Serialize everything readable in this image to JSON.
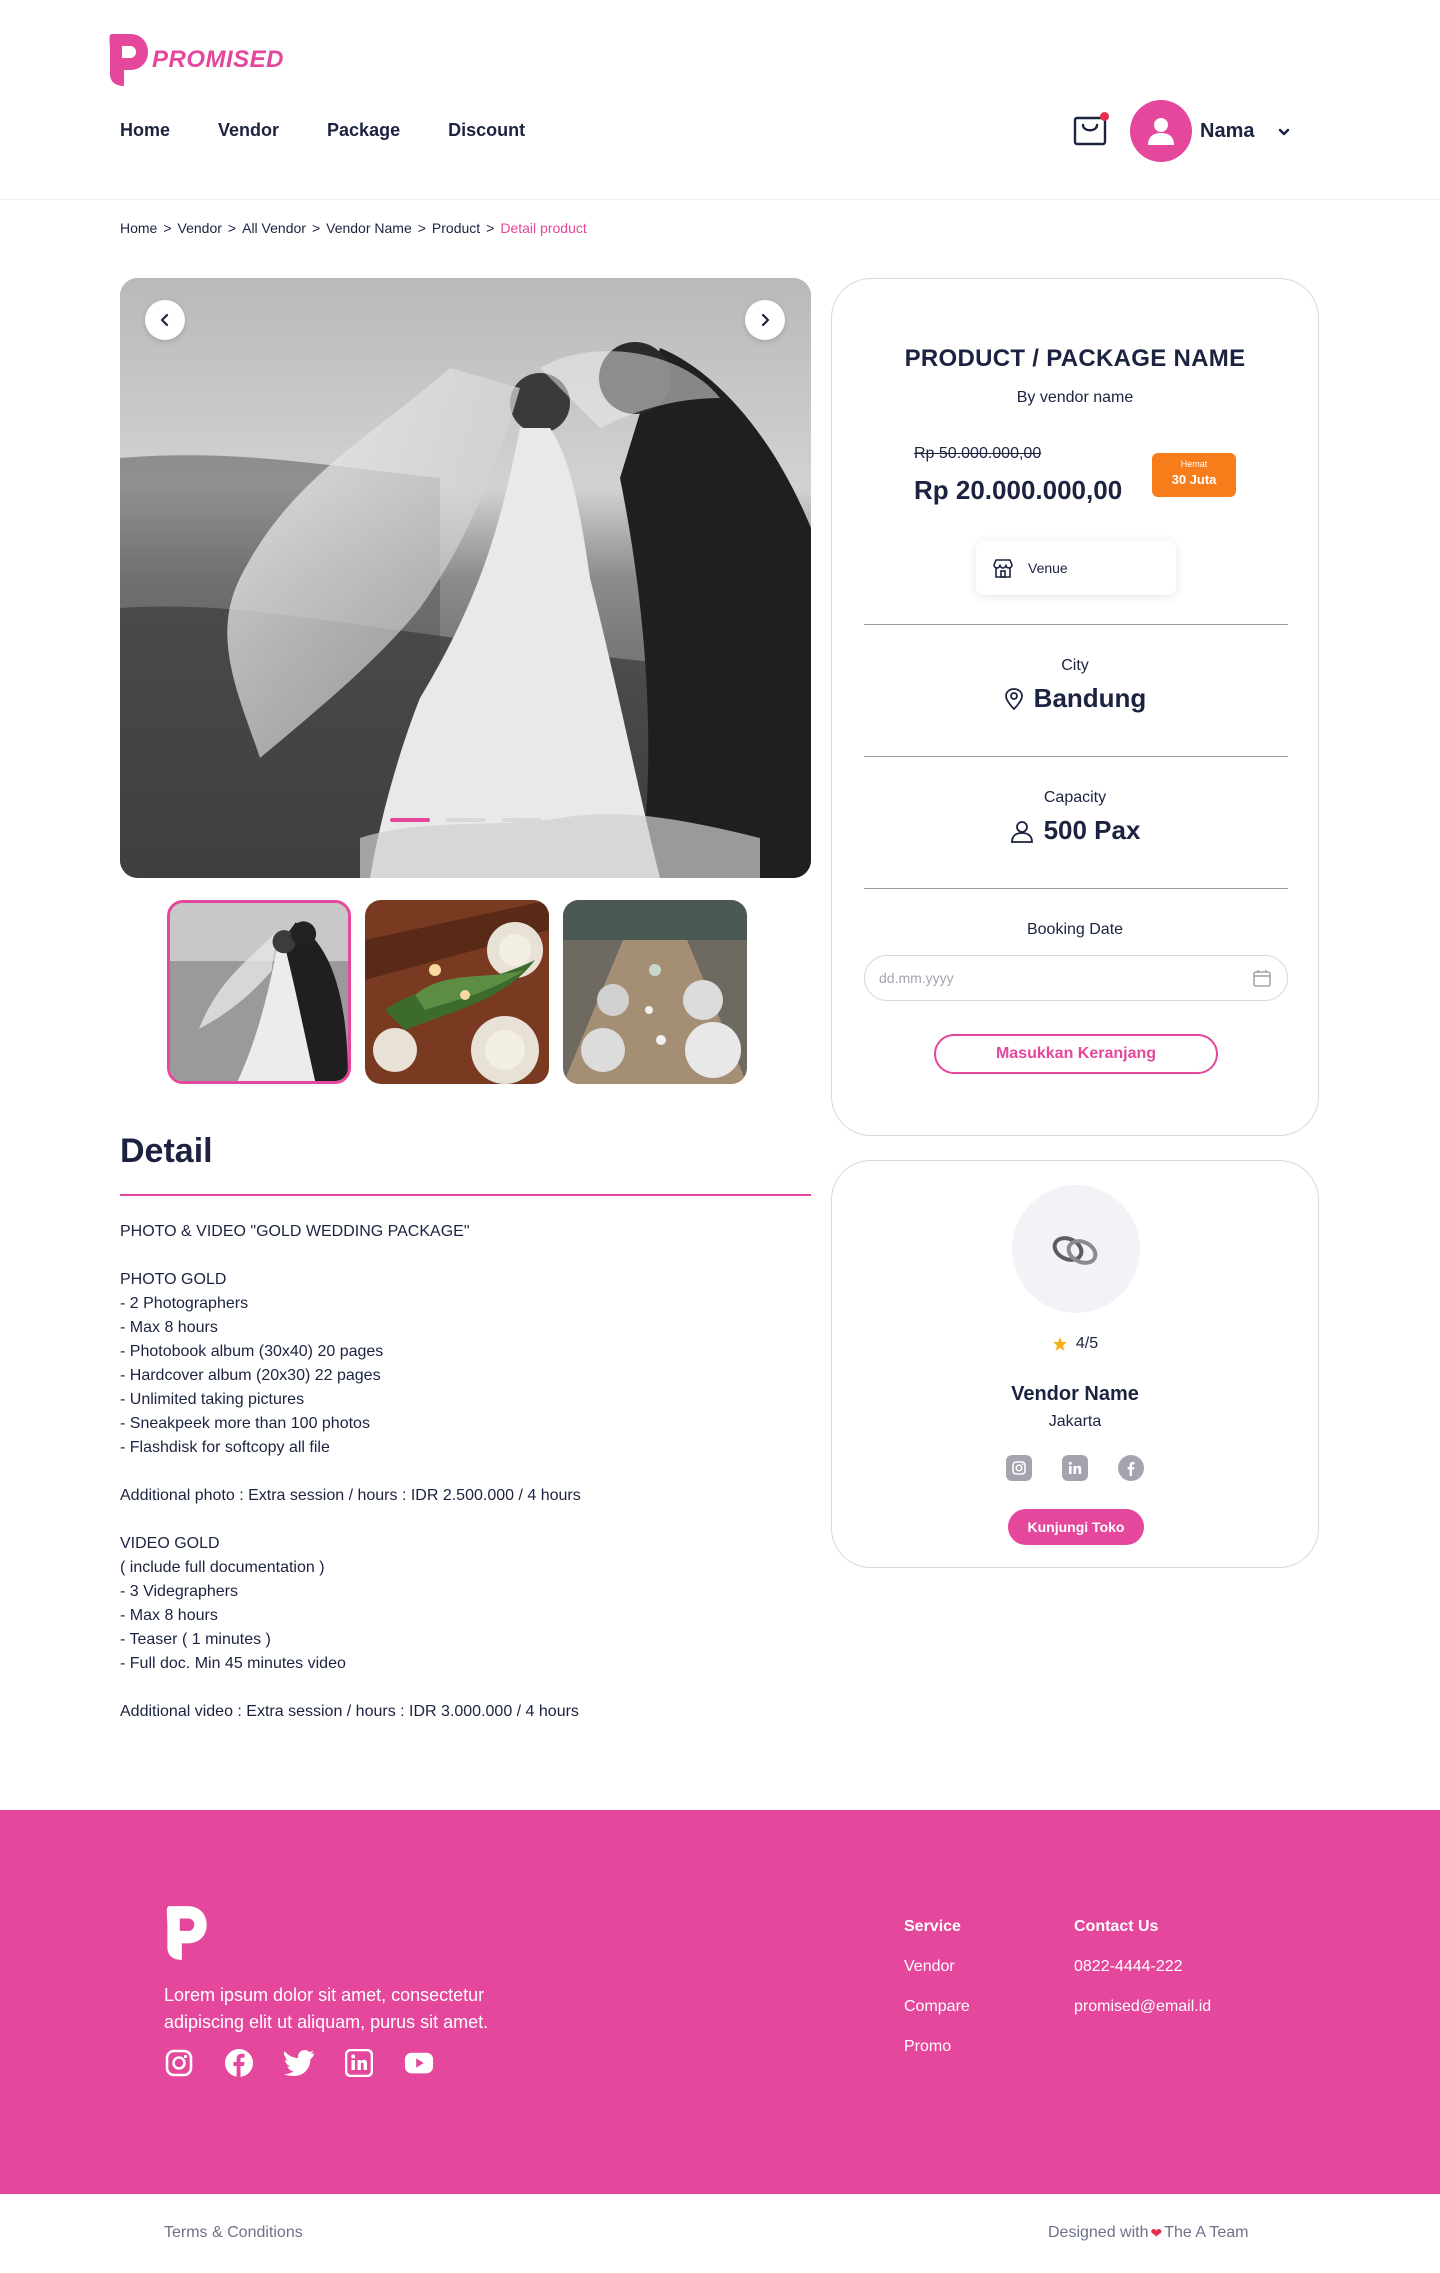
{
  "brand": {
    "name": "PROMISED",
    "logo_icon": "p-logo-icon",
    "color": "#e4479b"
  },
  "nav": {
    "items": [
      {
        "label": "Home"
      },
      {
        "label": "Vendor"
      },
      {
        "label": "Package"
      },
      {
        "label": "Discount"
      }
    ]
  },
  "user": {
    "name": "Nama",
    "cart_icon": "shopping-bag-icon",
    "has_notification": true
  },
  "breadcrumb": {
    "items": [
      "Home",
      "Vendor",
      "All Vendor",
      "Vendor Name",
      "Product"
    ],
    "current": "Detail product"
  },
  "gallery": {
    "slide_count": 3,
    "active_index": 0,
    "thumbnails": [
      {
        "label": "wedding-couple"
      },
      {
        "label": "table-setting-greenery"
      },
      {
        "label": "long-table-setting"
      }
    ]
  },
  "detail": {
    "title": "Detail",
    "lines": [
      "PHOTO & VIDEO \"GOLD WEDDING PACKAGE\"",
      "",
      "PHOTO GOLD",
      "- 2 Photographers",
      "- Max 8 hours",
      "- Photobook album (30x40) 20 pages",
      "- Hardcover album (20x30) 22 pages",
      "- Unlimited taking pictures",
      "- Sneakpeek more than 100 photos",
      "- Flashdisk for softcopy all file",
      "",
      "Additional photo : Extra session / hours : IDR 2.500.000 / 4 hours",
      "",
      "VIDEO GOLD",
      "( include full documentation )",
      "- 3 Videgraphers",
      "- Max 8 hours",
      "- Teaser ( 1 minutes )",
      "- Full doc. Min 45 minutes video",
      "",
      "Additional video : Extra session / hours : IDR 3.000.000 / 4 hours"
    ]
  },
  "product": {
    "name": "PRODUCT / PACKAGE NAME",
    "vendor": "By vendor name",
    "old_price": "Rp 50.000.000,00",
    "price": "Rp  20.000.000,00",
    "badge_label": "Hemat",
    "badge_value": "30 Juta",
    "badge_color": "#f77d1b",
    "category": "Venue",
    "city_label": "City",
    "city": "Bandung",
    "capacity_label": "Capacity",
    "capacity": "500 Pax",
    "booking_label": "Booking Date",
    "booking_placeholder": "dd.mm.yyyy",
    "cart_button": "Masukkan Keranjang"
  },
  "vendor": {
    "rating": "4/5",
    "name": "Vendor Name",
    "city": "Jakarta",
    "socials": [
      "instagram-icon",
      "linkedin-icon",
      "facebook-icon"
    ],
    "visit_button": "Kunjungi Toko"
  },
  "footer": {
    "text": "Lorem ipsum dolor sit amet, consectetur adipiscing elit ut aliquam, purus sit amet.",
    "socials": [
      "instagram-icon",
      "facebook-icon",
      "twitter-icon",
      "linkedin-icon",
      "youtube-icon"
    ],
    "service": {
      "title": "Service",
      "links": [
        "Vendor",
        "Compare",
        "Promo"
      ]
    },
    "contact": {
      "title": "Contact Us",
      "phone": "0822-4444-222",
      "email": "promised@email.id"
    },
    "terms": "Terms & Conditions",
    "credit_prefix": "Designed with",
    "credit_team": "The A Team"
  }
}
